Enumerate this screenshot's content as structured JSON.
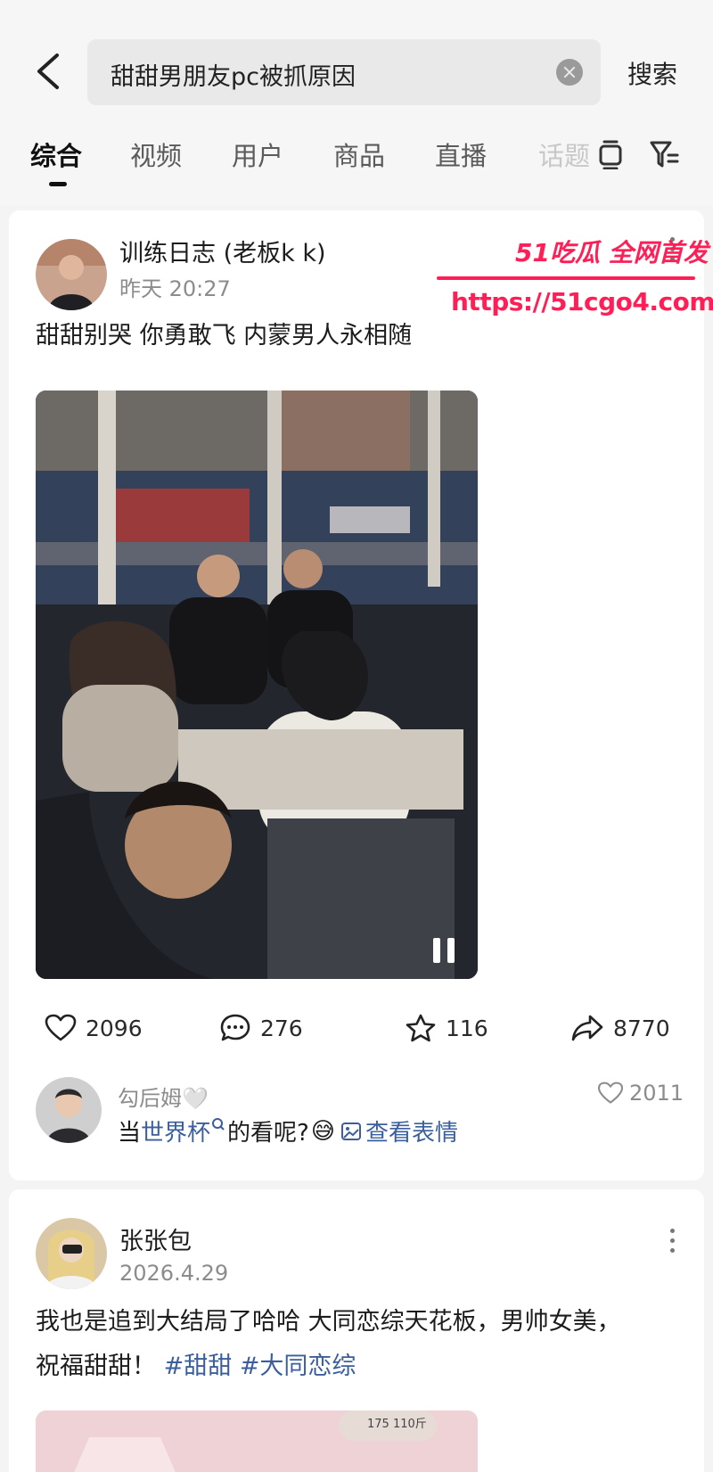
{
  "search": {
    "query": "甜甜男朋友pc被抓原因",
    "submit_label": "搜索"
  },
  "tabs": [
    {
      "label": "综合",
      "active": true
    },
    {
      "label": "视频"
    },
    {
      "label": "用户"
    },
    {
      "label": "商品"
    },
    {
      "label": "直播"
    },
    {
      "label": "话题"
    }
  ],
  "watermark": {
    "brand": "51吃瓜 全网首发",
    "url": "https://51cgo4.com"
  },
  "posts": [
    {
      "author": "训练日志 (老板k k)",
      "time": "昨天 20:27",
      "text": "甜甜别哭 你勇敢飞 内蒙男人永相随",
      "likes": "2096",
      "comments": "276",
      "favorites": "116",
      "shares": "8770",
      "top_comment": {
        "user": "勾后姆🤍",
        "text_before": "当",
        "link": "世界杯",
        "text_after": "的看呢?",
        "emoji": "😅",
        "view_sticker": "查看表情",
        "likes": "2011"
      }
    },
    {
      "author": "张张包",
      "time": "2026.4.29",
      "text": "我也是追到大结局了哈哈 大同恋综天花板，男帅女美，祝福甜甜！",
      "tags": [
        "#甜甜",
        "#大同恋综"
      ],
      "thumb_overlay": "175 110斤"
    }
  ],
  "colors": {
    "accent_link": "#3b5f9c",
    "watermark": "#ff1f56",
    "page_bg": "#f4f4f4"
  },
  "icons": {
    "back": "chevron-left-icon",
    "clear": "clear-icon",
    "like": "heart-icon",
    "comment": "comment-icon",
    "favorite": "star-icon",
    "share": "share-icon",
    "more": "more-vertical-icon",
    "filter": "filter-icon",
    "layout": "layout-icon",
    "pause": "pause-icon"
  }
}
